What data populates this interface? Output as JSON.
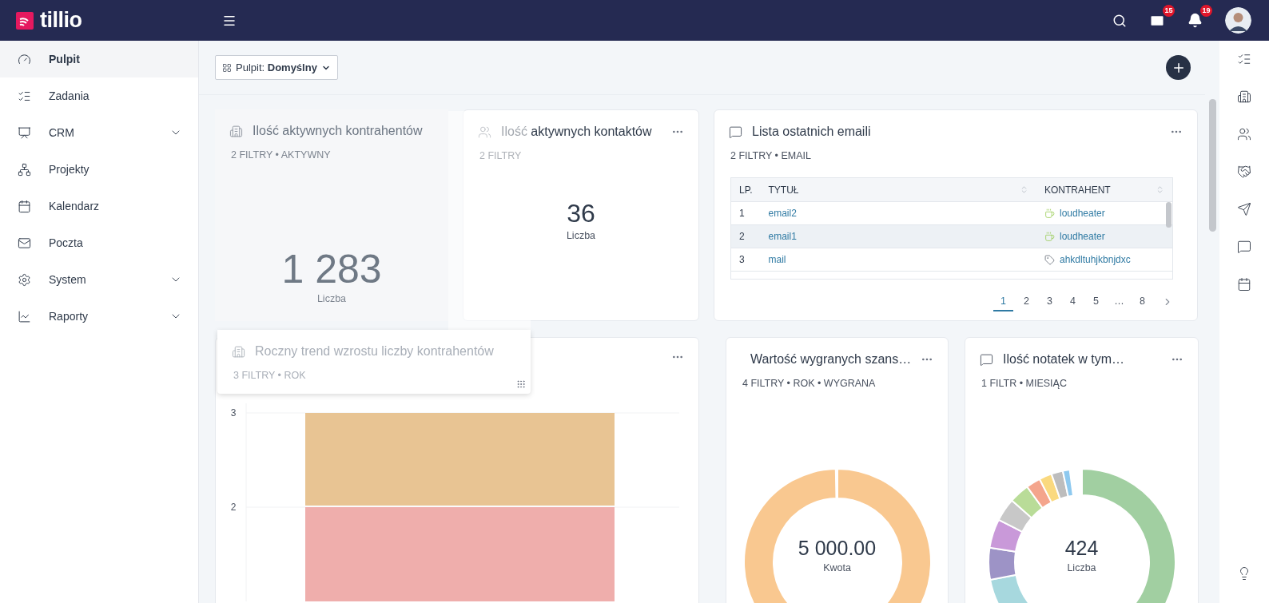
{
  "app": {
    "logo": "tillio"
  },
  "header": {
    "mail_badge": "15",
    "notification_badge": "19"
  },
  "sidebar": {
    "items": [
      {
        "label": "Pulpit",
        "selected": true,
        "expandable": false
      },
      {
        "label": "Zadania",
        "selected": false,
        "expandable": false
      },
      {
        "label": "CRM",
        "selected": false,
        "expandable": true
      },
      {
        "label": "Projekty",
        "selected": false,
        "expandable": false
      },
      {
        "label": "Kalendarz",
        "selected": false,
        "expandable": false
      },
      {
        "label": "Poczta",
        "selected": false,
        "expandable": false
      },
      {
        "label": "System",
        "selected": false,
        "expandable": true
      },
      {
        "label": "Raporty",
        "selected": false,
        "expandable": true
      }
    ]
  },
  "toolbar": {
    "dashboard": "Pulpit: **Domyślny**"
  },
  "placeholder_widget": {
    "title": "Ilość aktywnych kontrahentów",
    "meta": "2 FILTRY • AKTYWNY",
    "value": "1 283",
    "caption": "Liczba"
  },
  "contacts_widget": {
    "title": "Ilość aktywnych kontaktów",
    "meta": "2 FILTRY",
    "value": "36",
    "caption": "Liczba"
  },
  "email_widget": {
    "title": "Lista ostatnich emaili",
    "meta": "2 FILTRY • EMAIL",
    "table": {
      "columns": [
        "LP.",
        "TYTUŁ",
        "KONTRAHENT"
      ],
      "rows": [
        {
          "number": "1",
          "title": "email2",
          "contractor": "loudheater",
          "kind": "cup",
          "highlighted": false
        },
        {
          "number": "2",
          "title": "email1",
          "contractor": "loudheater",
          "kind": "cup",
          "highlighted": true
        },
        {
          "number": "3",
          "title": "mail",
          "contractor": "ahkdltuhjkbnjdxc",
          "kind": "tag",
          "highlighted": false
        }
      ]
    },
    "pagination": [
      {
        "label": "1",
        "selected": true
      },
      {
        "label": "2",
        "selected": false
      },
      {
        "label": "3",
        "selected": false
      },
      {
        "label": "4",
        "selected": false
      },
      {
        "label": "5",
        "selected": false
      },
      {
        "label": "…",
        "selected": false
      },
      {
        "label": "8",
        "selected": false
      }
    ]
  },
  "trend_widget": {
    "chart_data": {
      "type": "bar",
      "stacked": true,
      "ylim": [
        1,
        3
      ],
      "yticks": [
        2,
        3
      ],
      "series": [
        {
          "color": "#efaeac",
          "values": [
            2
          ]
        },
        {
          "color": "#e8c493",
          "values": [
            1
          ]
        }
      ]
    }
  },
  "won_value_widget": {
    "title": "Wartość wygranych szans…",
    "meta": "4 FILTRY • ROK • WYGRANA",
    "value": "5 000.00",
    "caption": "Kwota"
  },
  "notes_widget": {
    "title": "Ilość notatek w tym…",
    "meta": "1 FILTR • MIESIĄC",
    "value": "424",
    "caption": "Liczba"
  },
  "drag_preview": {
    "title": "Roczny trend wzrostu liczby kontrahentów",
    "meta": "3 FILTRY • ROK"
  }
}
